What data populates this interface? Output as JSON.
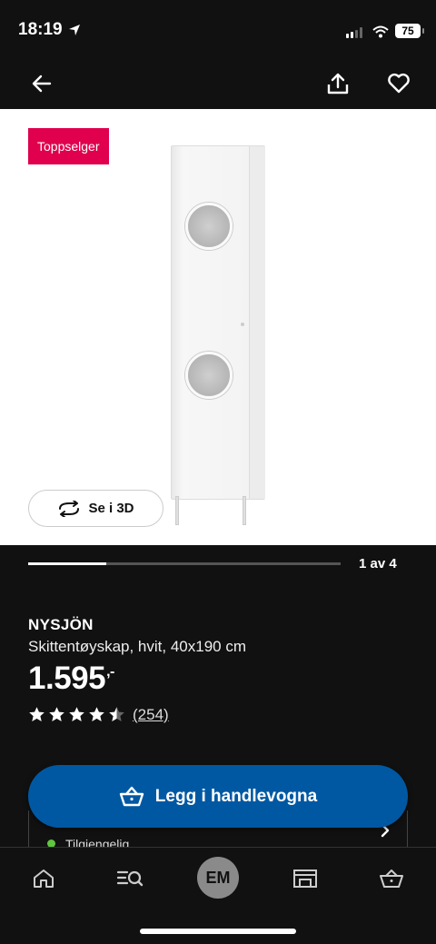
{
  "status_bar": {
    "time": "18:19",
    "battery": "75"
  },
  "product": {
    "badge": "Toppselger",
    "view_3d_label": "Se i 3D",
    "image_index": "1 av 4",
    "image_progress": 0.25,
    "brand": "NYSJÖN",
    "description": "Skittentøyskap, hvit, 40x190 cm",
    "price": "1.595",
    "price_suffix": ",-",
    "rating": 4.5,
    "rating_count": "(254)"
  },
  "availability": {
    "status": "Tilgjengelig",
    "color": "#5fc63f"
  },
  "cta": {
    "label": "Legg i handlevogna",
    "color": "#0058a3"
  },
  "tabbar": {
    "avatar_initials": "EM"
  },
  "colors": {
    "badge": "#e0004d",
    "background": "#111111"
  }
}
